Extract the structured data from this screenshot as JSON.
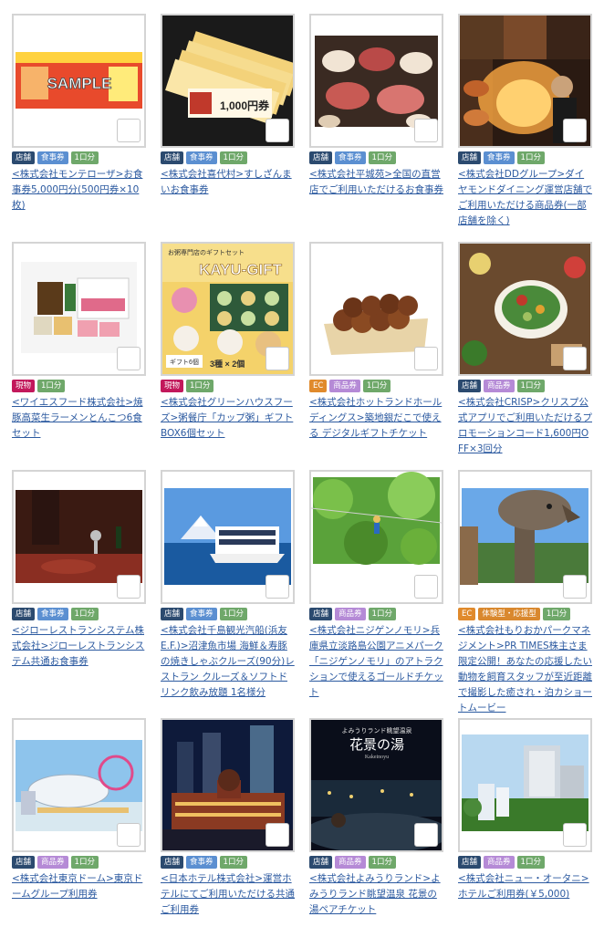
{
  "tag_colors": {
    "店舗": "#2b4a6f",
    "食事券": "#5b8fd1",
    "1口分": "#6fa86a",
    "現物": "#c2185b",
    "EC": "#e08a2c",
    "商品券": "#b58ad6",
    "体験型・応援型": "#d9882e"
  },
  "cards": [
    {
      "tags": [
        "店舗",
        "食事券",
        "1口分"
      ],
      "title": "<株式会社モンテローザ>お食事券5,000円分(500円券×10枚)",
      "image_text": "SAMPLE",
      "icon": "favorite-icon"
    },
    {
      "tags": [
        "店舗",
        "食事券",
        "1口分"
      ],
      "title": "<株式会社喜代村>すしざんまいお食事券",
      "image_text": "1,000円券",
      "icon": "favorite-icon"
    },
    {
      "tags": [
        "店舗",
        "食事券",
        "1口分"
      ],
      "title": "<株式会社平城苑>全国の直営店でご利用いただけるお食事券",
      "image_text": "",
      "icon": "favorite-icon"
    },
    {
      "tags": [
        "店舗",
        "食事券",
        "1口分"
      ],
      "title": "<株式会社DDグループ>ダイヤモンドダイニング運営店舗でご利用いただける商品券(一部店舗を除く)",
      "image_text": "",
      "icon": "favorite-icon"
    },
    {
      "tags": [
        "現物",
        "1口分"
      ],
      "title": "<ワイエスフード株式会社>焼豚高菜生ラーメンとんこつ6食セット",
      "image_text": "",
      "icon": "favorite-icon"
    },
    {
      "tags": [
        "現物",
        "1口分"
      ],
      "title": "<株式会社グリーンハウスフーズ>粥餐庁「カップ粥」ギフトBOX6個セット",
      "image_text": "KAYU-GIFT",
      "image_sub": "3種 × 2個",
      "image_badge": "ギフト6個",
      "image_top": "お粥専門店のギフトセット",
      "icon": "favorite-icon"
    },
    {
      "tags": [
        "EC",
        "商品券",
        "1口分"
      ],
      "title": "<株式会社ホットランドホールディングス>築地銀だこで使える デジタルギフトチケット",
      "image_text": "",
      "icon": "favorite-icon"
    },
    {
      "tags": [
        "店舗",
        "商品券",
        "1口分"
      ],
      "title": "<株式会社CRISP>クリスプ公式アプリでご利用いただけるプロモーションコード1,600円OFF×3回分",
      "image_text": "",
      "icon": "favorite-icon"
    },
    {
      "tags": [
        "店舗",
        "食事券",
        "1口分"
      ],
      "title": "<ジローレストランシステム株式会社>ジローレストランシステム共通お食事券",
      "image_text": "",
      "icon": "favorite-icon"
    },
    {
      "tags": [
        "店舗",
        "食事券",
        "1口分"
      ],
      "title": "<株式会社千島観光汽船(浜友E.F.)>沼津魚市場 海鮮＆寿豚の焼きしゃぶクルーズ(90分)レストラン クルーズ＆ソフトドリンク飲み放題 1名様分",
      "image_text": "",
      "icon": "favorite-icon"
    },
    {
      "tags": [
        "店舗",
        "商品券",
        "1口分"
      ],
      "title": "<株式会社ニジゲンノモリ>兵庫県立淡路島公園アニメパーク「ニジゲンノモリ」のアトラクションで使えるゴールドチケット",
      "image_text": "",
      "icon": "favorite-icon"
    },
    {
      "tags": [
        "EC",
        "体験型・応援型",
        "1口分"
      ],
      "title": "<株式会社もりおかパークマネジメント>PR TIMES株主さま限定公開！あなたの応援したい動物を飼育スタッフが至近距離で撮影した癒され・泊カショートムービー",
      "image_text": "",
      "icon": "favorite-icon"
    },
    {
      "tags": [
        "店舗",
        "商品券",
        "1口分"
      ],
      "title": "<株式会社東京ドーム>東京ドームグループ利用券",
      "image_text": "",
      "icon": "favorite-icon"
    },
    {
      "tags": [
        "店舗",
        "食事券",
        "1口分"
      ],
      "title": "<日本ホテル株式会社>運営ホテルにてご利用いただける共通ご利用券",
      "image_text": "",
      "icon": "favorite-icon"
    },
    {
      "tags": [
        "店舗",
        "商品券",
        "1口分"
      ],
      "title": "<株式会社よみうりランド>よみうりランド眺望温泉 花景の湯ペアチケット",
      "image_text": "花景の湯",
      "image_sub": "Kakeinoyu",
      "image_top": "よみうりランド眺望温泉",
      "icon": "favorite-icon"
    },
    {
      "tags": [
        "店舗",
        "商品券",
        "1口分"
      ],
      "title": "<株式会社ニュー・オータニ>ホテルご利用券(￥5,000)",
      "image_text": "",
      "icon": "favorite-icon"
    }
  ]
}
